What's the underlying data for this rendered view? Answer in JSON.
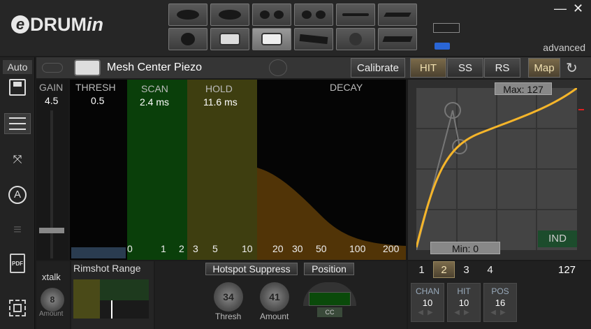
{
  "app": {
    "logo_prefix": "e",
    "logo_main": "DRUM",
    "logo_suffix": "in",
    "advanced_label": "advanced"
  },
  "window": {
    "minimize": "—",
    "close": "✕"
  },
  "sidebar": {
    "auto_label": "Auto"
  },
  "header": {
    "pad_name": "Mesh Center Piezo",
    "calibrate": "Calibrate",
    "tabs": [
      "HIT",
      "SS",
      "RS"
    ],
    "map": "Map"
  },
  "gain": {
    "label": "GAIN",
    "value": "4.5"
  },
  "graph": {
    "thresh": {
      "label": "THRESH",
      "value": "0.5"
    },
    "scan": {
      "label": "SCAN",
      "value": "2.4 ms"
    },
    "hold": {
      "label": "HOLD",
      "value": "11.6 ms"
    },
    "decay": {
      "label": "DECAY"
    },
    "axis": [
      "0",
      "1",
      "2",
      "3",
      "5",
      "10",
      "20",
      "30",
      "50",
      "100",
      "200"
    ]
  },
  "curve": {
    "max_label": "Max: 127",
    "min_label": "Min: 0",
    "ind": "IND"
  },
  "xtalk": {
    "label": "xtalk",
    "value": "8",
    "amount": "Amount"
  },
  "rimshot": {
    "label": "Rimshot Range"
  },
  "hotspot": {
    "suppress": "Hotspot Suppress",
    "position": "Position",
    "thresh_value": "34",
    "thresh_label": "Thresh",
    "amount_value": "41",
    "amount_label": "Amount",
    "cc_label": "CC"
  },
  "zones": {
    "tabs": [
      "1",
      "2",
      "3",
      "4"
    ],
    "velocity": "127",
    "cells": [
      {
        "h": "CHAN",
        "v": "10"
      },
      {
        "h": "HIT",
        "v": "10"
      },
      {
        "h": "POS",
        "v": "16"
      }
    ]
  },
  "colors": {
    "accent_orange": "#f5b52a",
    "scan_green": "#0a4a0a",
    "hold_yellow": "#4a4a10",
    "decay_brown": "#5a3a08"
  }
}
